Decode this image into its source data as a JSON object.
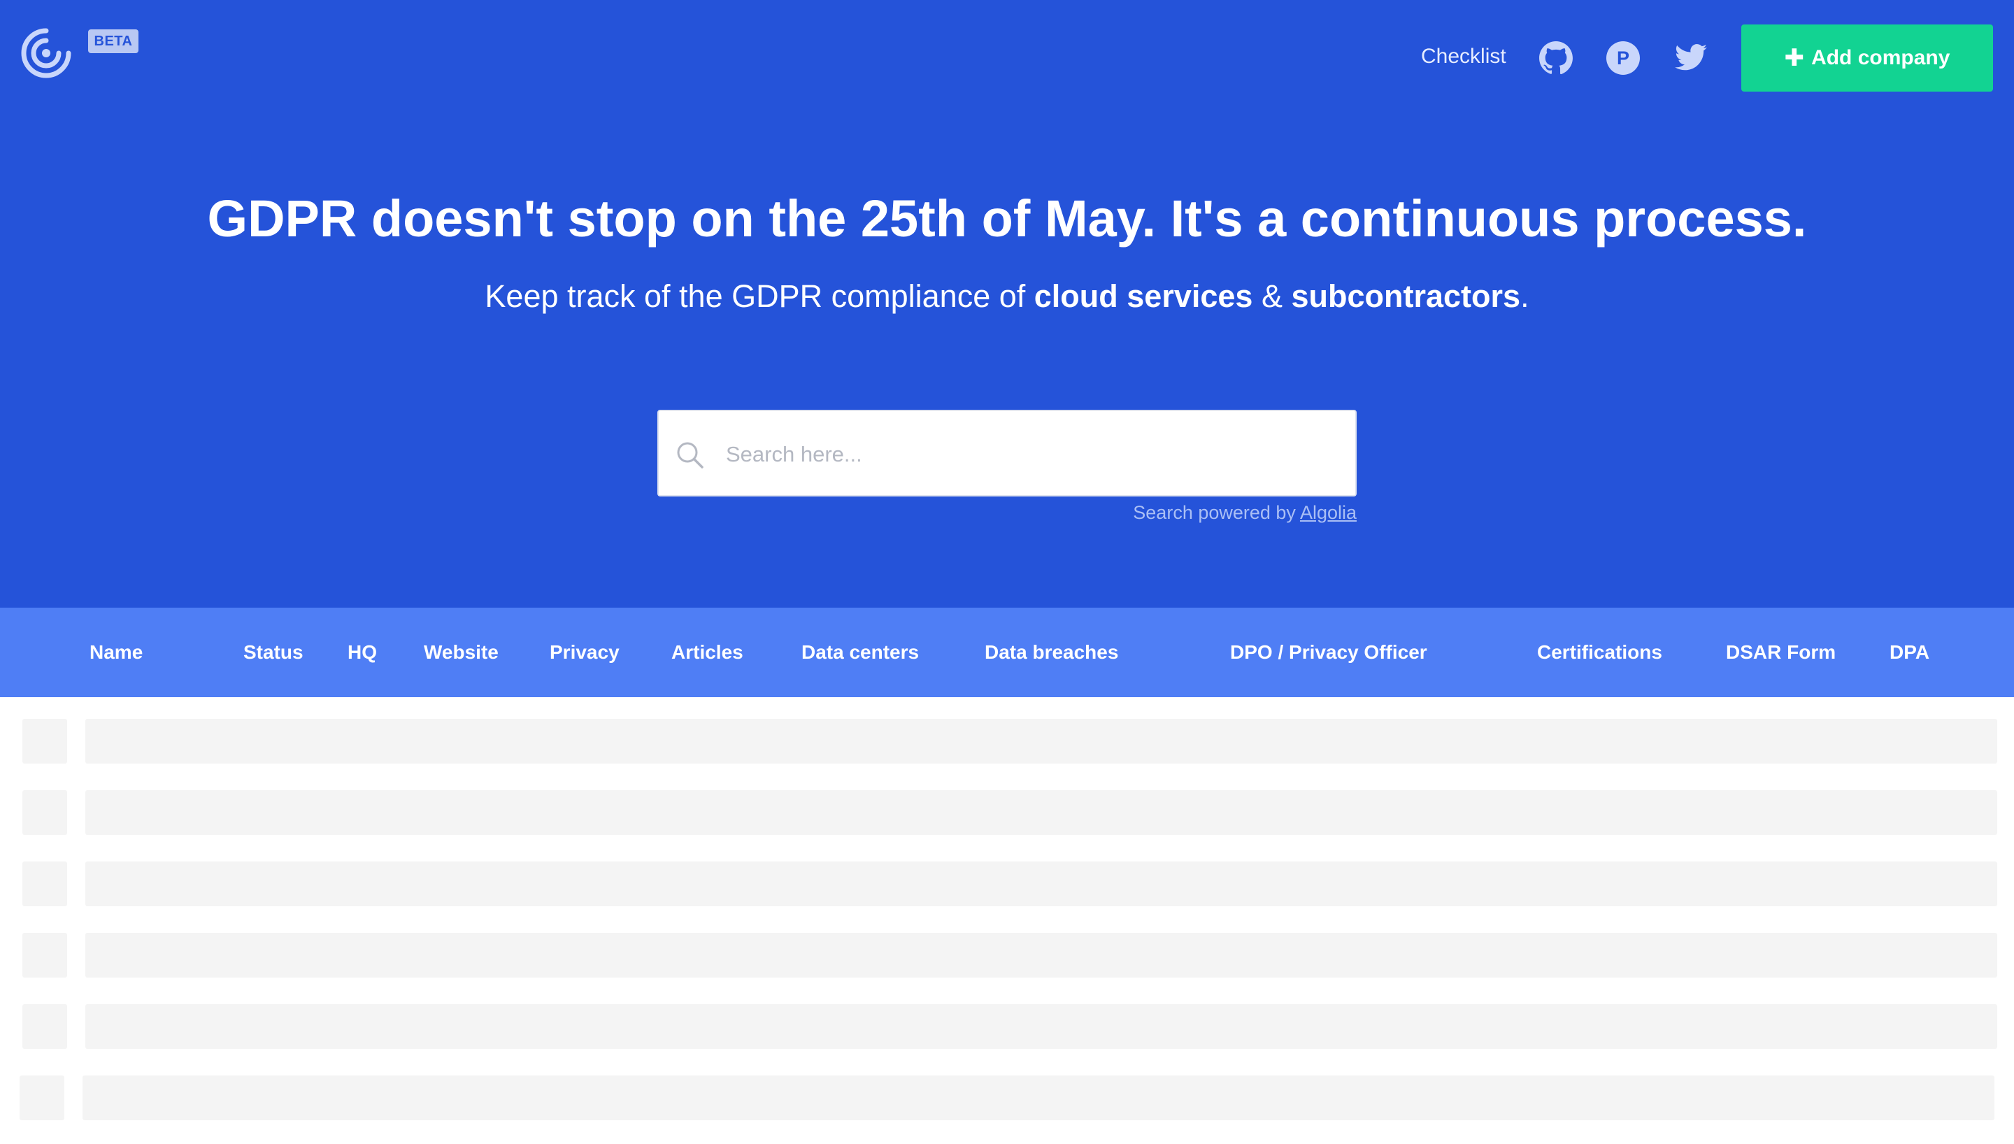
{
  "header": {
    "beta_label": "BETA",
    "nav": {
      "checklist": "Checklist",
      "icons": [
        "github-icon",
        "producthunt-icon",
        "twitter-icon"
      ],
      "producthunt_letter": "P"
    },
    "add_company_label": "Add company"
  },
  "hero": {
    "headline": "GDPR doesn't stop on the 25th of May. It's a continuous process.",
    "subline_prefix": "Keep track of the GDPR compliance of ",
    "subline_bold_1": "cloud services",
    "subline_mid": " & ",
    "subline_bold_2": "subcontractors",
    "subline_suffix": "."
  },
  "search": {
    "placeholder": "Search here...",
    "powered_prefix": "Search powered by ",
    "powered_link": "Algolia"
  },
  "table": {
    "columns": [
      "Name",
      "Status",
      "HQ",
      "Website",
      "Privacy",
      "Articles",
      "Data centers",
      "Data breaches",
      "DPO / Privacy Officer",
      "Certifications",
      "DSAR Form",
      "DPA"
    ],
    "loading_rows": 6
  },
  "colors": {
    "hero_bg": "#2553d9",
    "table_header_bg": "#4f7ef5",
    "add_button_bg": "#12d392",
    "skeleton": "#f4f4f4"
  }
}
